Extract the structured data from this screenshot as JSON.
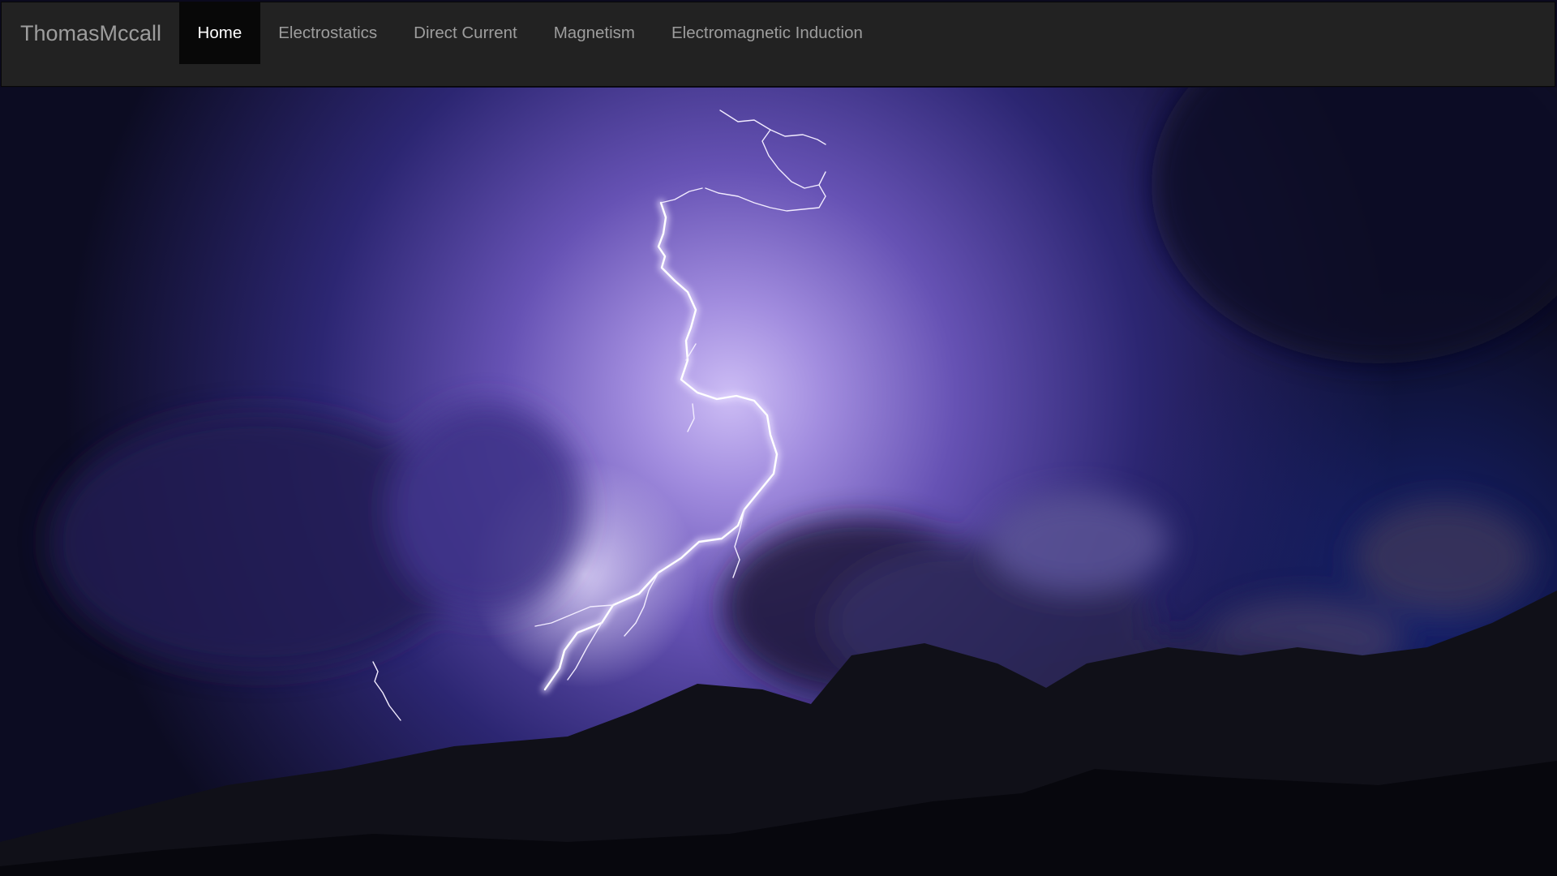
{
  "brand": "ThomasMccall",
  "nav": {
    "items": [
      {
        "label": "Home",
        "active": true
      },
      {
        "label": "Electrostatics",
        "active": false
      },
      {
        "label": "Direct Current",
        "active": false
      },
      {
        "label": "Magnetism",
        "active": false
      },
      {
        "label": "Electromagnetic Induction",
        "active": false
      }
    ]
  },
  "colors": {
    "navbar_bg": "#222222",
    "nav_text": "#9d9d9d",
    "nav_active_bg": "#080808",
    "nav_active_text": "#ffffff",
    "sky_glow": "#b39ee6",
    "sky_dark": "#141235"
  },
  "hero": {
    "subject": "lightning-storm-over-mountains-photo"
  }
}
